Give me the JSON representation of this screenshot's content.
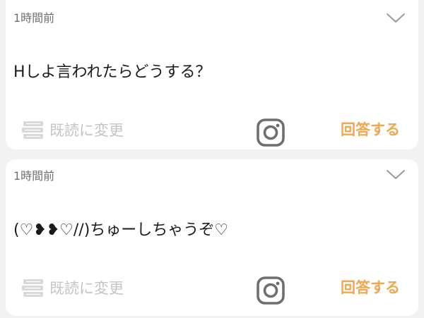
{
  "posts": [
    {
      "timestamp": "1時間前",
      "body": "Hしよ言われたらどうする？",
      "mark_read_label": "既読に変更",
      "answer_label": "回答する"
    },
    {
      "timestamp": "1時間前",
      "body": "(♡❥❥♡//)ちゅーしちゃうぞ♡",
      "mark_read_label": "既読に変更",
      "answer_label": "回答する"
    }
  ],
  "icons": {
    "expand": "chevron-down-icon",
    "mark_read": "books-stack-icon",
    "share": "instagram-icon"
  },
  "colors": {
    "accent": "#f5a54a",
    "muted": "#c4c4c4",
    "icon": "#6f6f6f"
  }
}
